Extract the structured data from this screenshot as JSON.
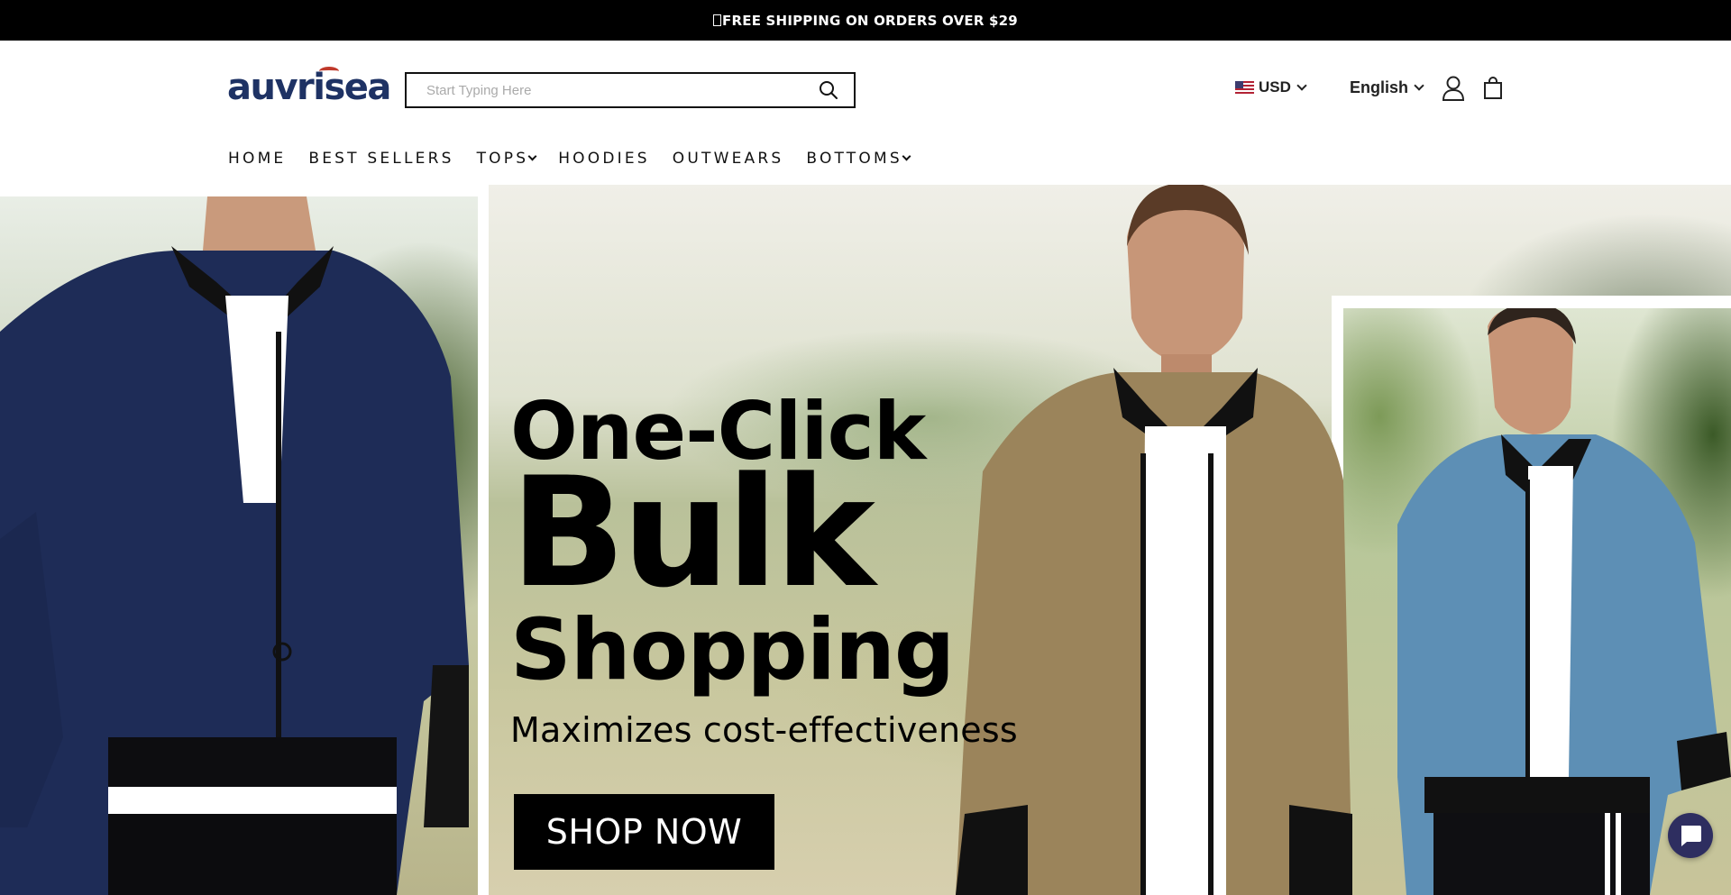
{
  "announcement": {
    "text": "FREE SHIPPING ON ORDERS OVER $29"
  },
  "brand": {
    "logo_text": "auvrisea",
    "logo_color": "#1e3264",
    "accent": "#c0392b"
  },
  "search": {
    "placeholder": "Start Typing Here",
    "value": ""
  },
  "header": {
    "currency": "USD",
    "language": "English"
  },
  "nav": {
    "items": [
      {
        "label": "HOME"
      },
      {
        "label": "BEST SELLERS"
      },
      {
        "label": "TOPS"
      },
      {
        "label": "HOODIES"
      },
      {
        "label": "OUTWEARS"
      },
      {
        "label": "BOTTOMS"
      }
    ]
  },
  "hero": {
    "line1": "One-Click",
    "line2": "Bulk",
    "line3": "Shopping",
    "subtitle": "Maximizes cost-effectiveness",
    "cta": "SHOP NOW"
  },
  "icons": {
    "search": "search-icon",
    "account": "user-icon",
    "cart": "shopping-bag-icon",
    "chat": "chat-icon",
    "flag": "us-flag-icon"
  },
  "colors": {
    "topbar": "#000000",
    "cta_bg": "#000000",
    "chat_bubble": "#2e2e60"
  }
}
